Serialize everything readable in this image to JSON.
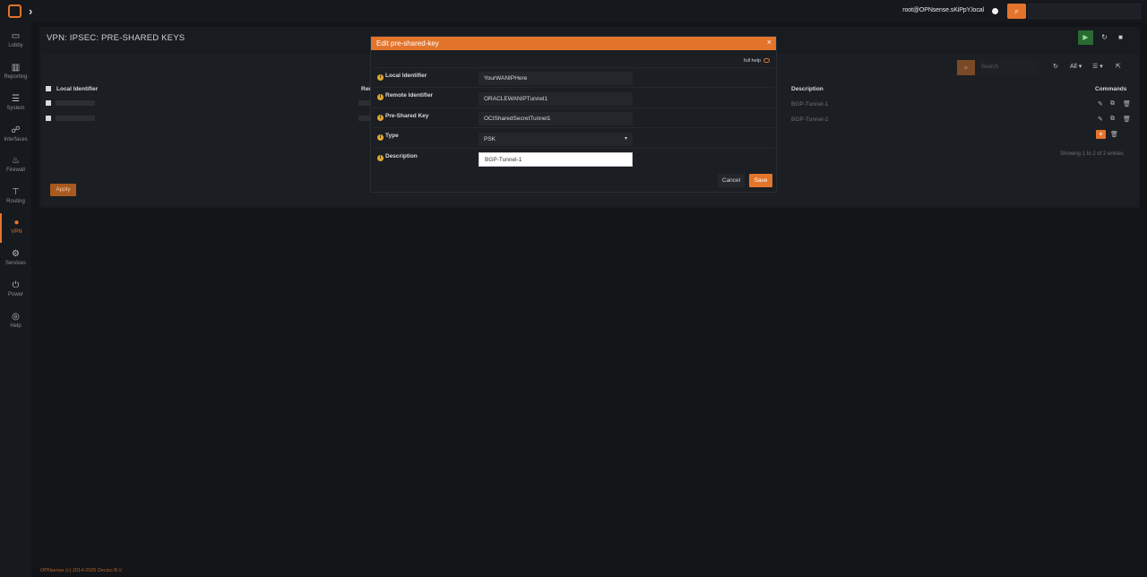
{
  "topbar": {
    "user": "root@OPNsense.sKiPpY.local",
    "search_icon": "search-icon",
    "colors": {
      "accent": "#e3742c",
      "background": "#121417"
    }
  },
  "sidebar": {
    "items": [
      {
        "label": "Lobby",
        "icon": "laptop-icon"
      },
      {
        "label": "Reporting",
        "icon": "chart-icon"
      },
      {
        "label": "System",
        "icon": "server-icon"
      },
      {
        "label": "Interfaces",
        "icon": "sitemap-icon"
      },
      {
        "label": "Firewall",
        "icon": "fire-icon"
      },
      {
        "label": "Routing",
        "icon": "signpost-icon"
      },
      {
        "label": "VPN",
        "icon": "globe-icon",
        "active": true
      },
      {
        "label": "Services",
        "icon": "gear-icon"
      },
      {
        "label": "Power",
        "icon": "plug-icon"
      },
      {
        "label": "Help",
        "icon": "lifebuoy-icon"
      }
    ]
  },
  "page": {
    "title": "VPN: IPSEC: PRE-SHARED KEYS",
    "search_placeholder": "Search",
    "filter_all": "All",
    "columns": [
      "Local Identifier",
      "Rem",
      "Description",
      "Commands"
    ],
    "rows": [
      {
        "description": "BGP-Tunnel-1"
      },
      {
        "description": "BGP-Tunnel-2"
      }
    ],
    "showing": "Showing 1 to 2 of 2 entries",
    "apply_label": "Apply"
  },
  "modal": {
    "title": "Edit pre-shared-key",
    "close": "×",
    "full_help": "full help",
    "fields": [
      {
        "label": "Local Identifier",
        "value": "YourWANIPHere"
      },
      {
        "label": "Remote Identifier",
        "value": "ORACLEWANIPTunnel1"
      },
      {
        "label": "Pre-Shared Key",
        "value": "OCISharedSecretTunnel1"
      },
      {
        "label": "Type",
        "value": "PSK"
      },
      {
        "label": "Description",
        "value": "BGP-Tunnel-1"
      }
    ],
    "cancel_label": "Cancel",
    "save_label": "Save"
  },
  "footer": {
    "text": "OPNsense (c) 2014-2025 Deciso B.V."
  }
}
